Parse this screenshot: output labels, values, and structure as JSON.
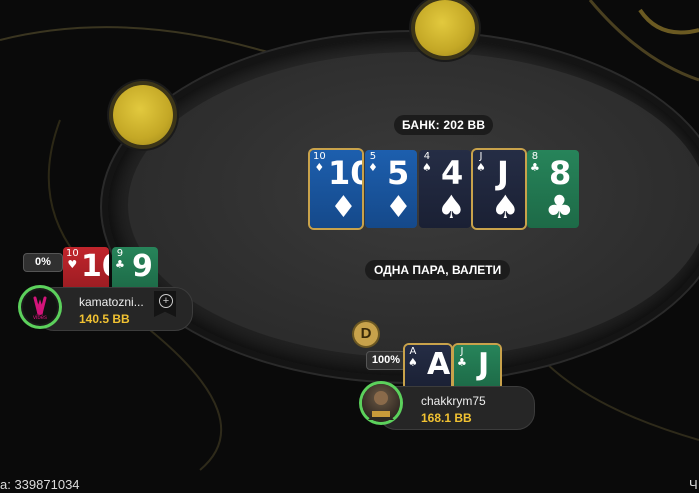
{
  "table": {
    "pot_label": "БАНК: 202 BB",
    "hand_name": "ОДНА ПАРА, ВАЛЕТИ",
    "dealer_label": "D"
  },
  "board": [
    {
      "rank": "10",
      "suit": "♦",
      "color": "blue"
    },
    {
      "rank": "5",
      "suit": "♦",
      "color": "blue"
    },
    {
      "rank": "4",
      "suit": "♠",
      "color": "navy"
    },
    {
      "rank": "J",
      "suit": "♠",
      "color": "navy"
    },
    {
      "rank": "8",
      "suit": "♣",
      "color": "green"
    }
  ],
  "players": {
    "left": {
      "name": "kamatozni...",
      "stack": "140.5 BB",
      "equity": "0%",
      "avatar_text": "vibes",
      "cards": [
        {
          "rank": "10",
          "suit": "♥",
          "color": "red"
        },
        {
          "rank": "9",
          "suit": "♣",
          "color": "green"
        }
      ]
    },
    "hero": {
      "name": "chakkrym75",
      "stack": "168.1 BB",
      "equity": "100%",
      "cards": [
        {
          "rank": "A",
          "suit": "♠",
          "color": "navy"
        },
        {
          "rank": "J",
          "suit": "♣",
          "color": "green"
        }
      ]
    }
  },
  "footer": {
    "hand_id": "а: 339871034",
    "right_text": "Ч"
  },
  "colors": {
    "accent_gold": "#c8a24b",
    "stack_yellow": "#f1c232",
    "seat_ring_green": "#5cd15c"
  }
}
